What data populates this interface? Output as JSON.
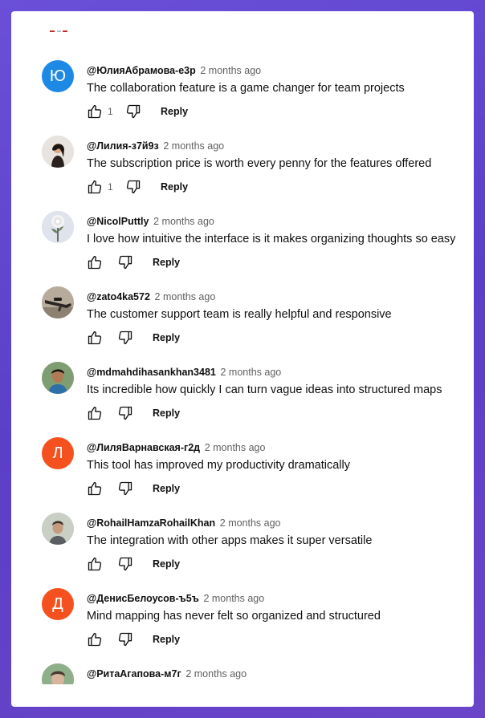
{
  "comments": [
    {
      "author": "@ЮлияАбрамова-е3р",
      "time": "2 months ago",
      "text": "The collaboration feature is a game changer for team projects",
      "likes": "1",
      "avatar_letter": "Ю",
      "avatar_color": "#1e88e5",
      "reply_label": "Reply"
    },
    {
      "author": "@Лилия-з7й9з",
      "time": "2 months ago",
      "text": "The subscription price is worth every penny for the features offered",
      "likes": "1",
      "avatar_letter": "",
      "avatar_color": "#d8d3cf",
      "reply_label": "Reply"
    },
    {
      "author": "@NicolPuttly",
      "time": "2 months ago",
      "text": "I love how intuitive the interface is it makes organizing thoughts so easy",
      "likes": "",
      "avatar_letter": "",
      "avatar_color": "#d9dde8",
      "reply_label": "Reply"
    },
    {
      "author": "@zato4ka572",
      "time": "2 months ago",
      "text": "The customer support team is really helpful and responsive",
      "likes": "",
      "avatar_letter": "",
      "avatar_color": "#b9b0a4",
      "reply_label": "Reply"
    },
    {
      "author": "@mdmahdihasankhan3481",
      "time": "2 months ago",
      "text": "Its incredible how quickly I can turn vague ideas into structured maps",
      "likes": "",
      "avatar_letter": "",
      "avatar_color": "#7a9a6e",
      "reply_label": "Reply"
    },
    {
      "author": "@ЛиляВарнавская-г2д",
      "time": "2 months ago",
      "text": "This tool has improved my productivity dramatically",
      "likes": "",
      "avatar_letter": "Л",
      "avatar_color": "#f4511e",
      "reply_label": "Reply"
    },
    {
      "author": "@RohailHamzaRohailKhan",
      "time": "2 months ago",
      "text": "The integration with other apps makes it super versatile",
      "likes": "",
      "avatar_letter": "",
      "avatar_color": "#c5ccc0",
      "reply_label": "Reply"
    },
    {
      "author": "@ДенисБелоусов-ъ5ъ",
      "time": "2 months ago",
      "text": "Mind mapping has never felt so organized and structured",
      "likes": "",
      "avatar_letter": "Д",
      "avatar_color": "#f4511e",
      "reply_label": "Reply"
    },
    {
      "author": "@РитаАгапова-м7г",
      "time": "2 months ago",
      "text": "",
      "likes": "",
      "avatar_letter": "",
      "avatar_color": "#8fae8a",
      "reply_label": ""
    }
  ]
}
